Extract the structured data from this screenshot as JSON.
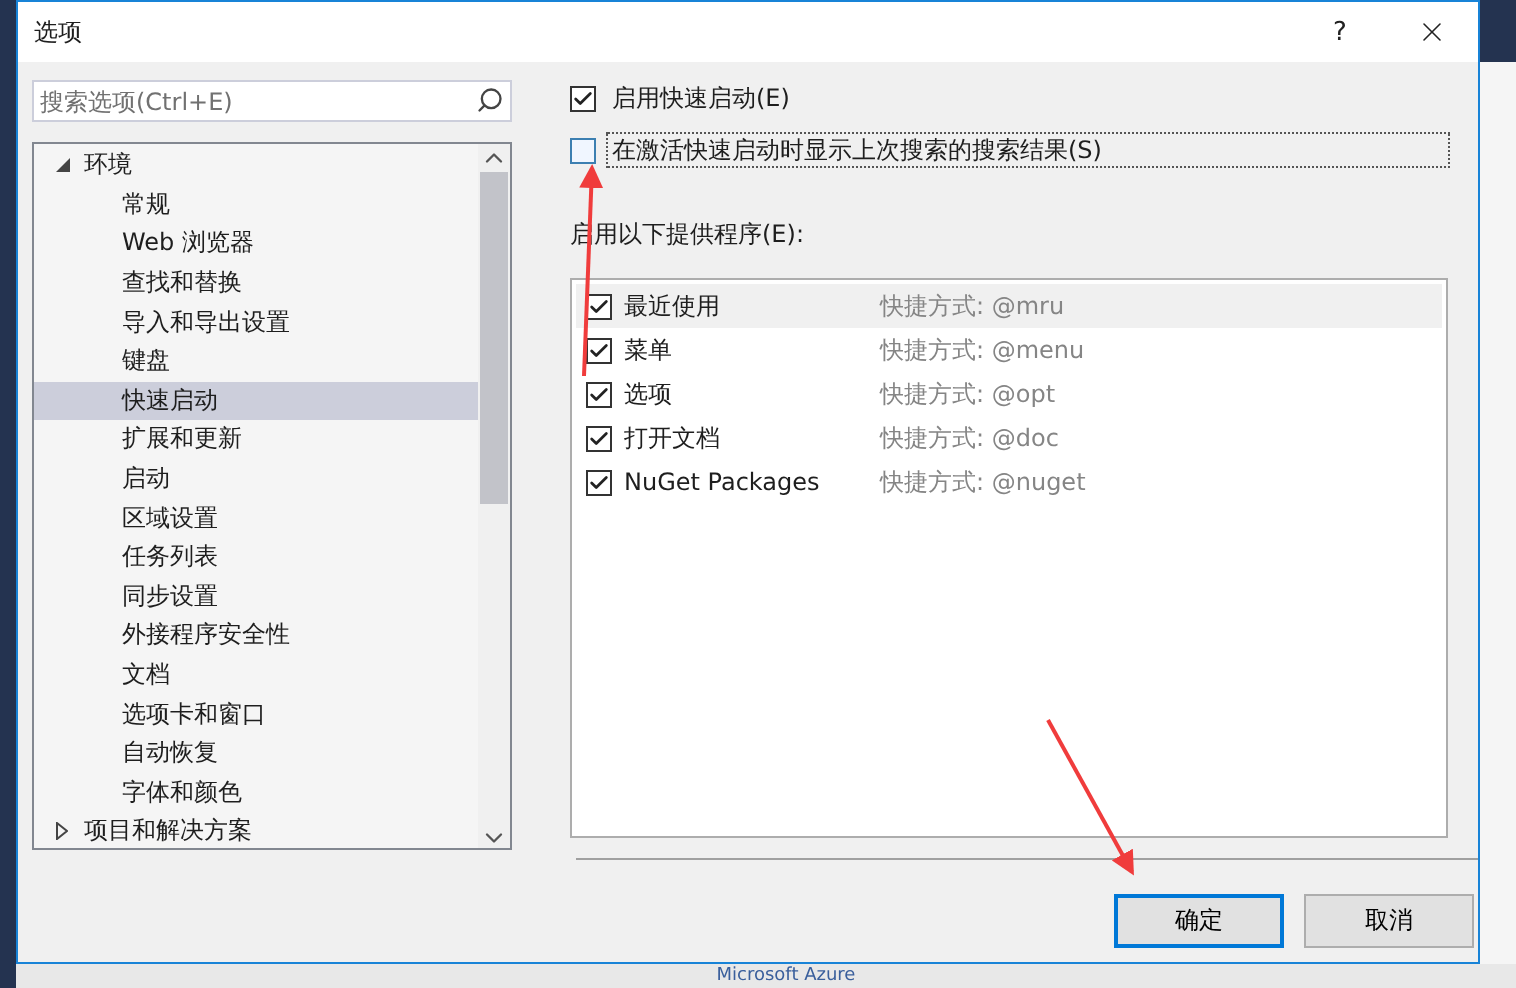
{
  "window": {
    "title": "选项",
    "help": "?"
  },
  "search": {
    "placeholder": "搜索选项(Ctrl+E)"
  },
  "tree": [
    {
      "label": "环境",
      "expanded": true,
      "selected": false,
      "children": [
        {
          "label": "常规",
          "selected": false
        },
        {
          "label": "Web 浏览器",
          "selected": false
        },
        {
          "label": "查找和替换",
          "selected": false
        },
        {
          "label": "导入和导出设置",
          "selected": false
        },
        {
          "label": "键盘",
          "selected": false
        },
        {
          "label": "快速启动",
          "selected": true
        },
        {
          "label": "扩展和更新",
          "selected": false
        },
        {
          "label": "启动",
          "selected": false
        },
        {
          "label": "区域设置",
          "selected": false
        },
        {
          "label": "任务列表",
          "selected": false
        },
        {
          "label": "同步设置",
          "selected": false
        },
        {
          "label": "外接程序安全性",
          "selected": false
        },
        {
          "label": "文档",
          "selected": false
        },
        {
          "label": "选项卡和窗口",
          "selected": false
        },
        {
          "label": "自动恢复",
          "selected": false
        },
        {
          "label": "字体和颜色",
          "selected": false
        }
      ]
    },
    {
      "label": "项目和解决方案",
      "expanded": false,
      "selected": false
    }
  ],
  "options": [
    {
      "label": "启用快速启动(E)",
      "checked": true,
      "focused": false
    },
    {
      "label": "在激活快速启动时显示上次搜索的搜索结果(S)",
      "checked": false,
      "focused": true
    }
  ],
  "providers_label": "启用以下提供程序(E):",
  "providers": [
    {
      "name": "最近使用",
      "shortcut": "快捷方式: @mru",
      "checked": true,
      "selected": true
    },
    {
      "name": "菜单",
      "shortcut": "快捷方式: @menu",
      "checked": true,
      "selected": false
    },
    {
      "name": "选项",
      "shortcut": "快捷方式: @opt",
      "checked": true,
      "selected": false
    },
    {
      "name": "打开文档",
      "shortcut": "快捷方式: @doc",
      "checked": true,
      "selected": false
    },
    {
      "name": "NuGet Packages",
      "shortcut": "快捷方式: @nuget",
      "checked": true,
      "selected": false
    }
  ],
  "buttons": [
    {
      "label": "确定",
      "default": true
    },
    {
      "label": "取消",
      "default": false
    }
  ],
  "background_text": "Microsoft Azure"
}
